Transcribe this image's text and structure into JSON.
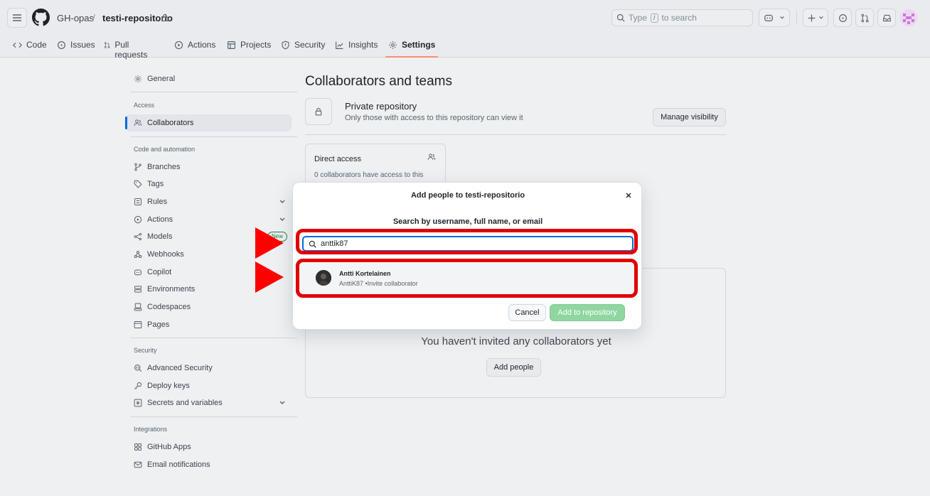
{
  "header": {
    "owner": "GH-opas",
    "separator": "/",
    "repo": "testi-repositorio",
    "search_prefix": "Type",
    "search_key": "/",
    "search_suffix": "to search"
  },
  "tabs": [
    {
      "label": "Code",
      "icon": "code-icon"
    },
    {
      "label": "Issues",
      "icon": "issue-icon"
    },
    {
      "label": "Pull requests",
      "icon": "pull-request-icon"
    },
    {
      "label": "Actions",
      "icon": "play-icon"
    },
    {
      "label": "Projects",
      "icon": "table-icon"
    },
    {
      "label": "Security",
      "icon": "shield-icon"
    },
    {
      "label": "Insights",
      "icon": "graph-icon"
    },
    {
      "label": "Settings",
      "icon": "gear-icon",
      "active": true
    }
  ],
  "sidebar": {
    "general": "General",
    "access_heading": "Access",
    "collaborators": "Collaborators",
    "code_heading": "Code and automation",
    "branches": "Branches",
    "tags": "Tags",
    "rules": "Rules",
    "actions": "Actions",
    "models": "Models",
    "models_badge": "New",
    "webhooks": "Webhooks",
    "copilot": "Copilot",
    "environments": "Environments",
    "codespaces": "Codespaces",
    "pages": "Pages",
    "security_heading": "Security",
    "advanced_security": "Advanced Security",
    "deploy_keys": "Deploy keys",
    "secrets": "Secrets and variables",
    "integrations_heading": "Integrations",
    "github_apps": "GitHub Apps",
    "email_notifications": "Email notifications"
  },
  "main": {
    "title": "Collaborators and teams",
    "private_title": "Private repository",
    "private_sub": "Only those with access to this repository can view it",
    "manage_visibility": "Manage visibility",
    "direct_access_title": "Direct access",
    "direct_access_sub": "0 collaborators have access to this",
    "empty_text": "You haven't invited any collaborators yet",
    "add_people": "Add people"
  },
  "modal": {
    "title": "Add people to testi-repositorio",
    "search_label": "Search by username, full name, or email",
    "search_value": "anttik87",
    "result_name": "Antti Kortelainen",
    "result_sub": "AnttiK87 •Invite collaborator",
    "cancel": "Cancel",
    "add": "Add to repository"
  },
  "colors": {
    "highlight": "#e00000",
    "arrow": "#ff0000",
    "primary_disabled": "#8fd6a0",
    "active_tab_underline": "#fd8c73"
  }
}
